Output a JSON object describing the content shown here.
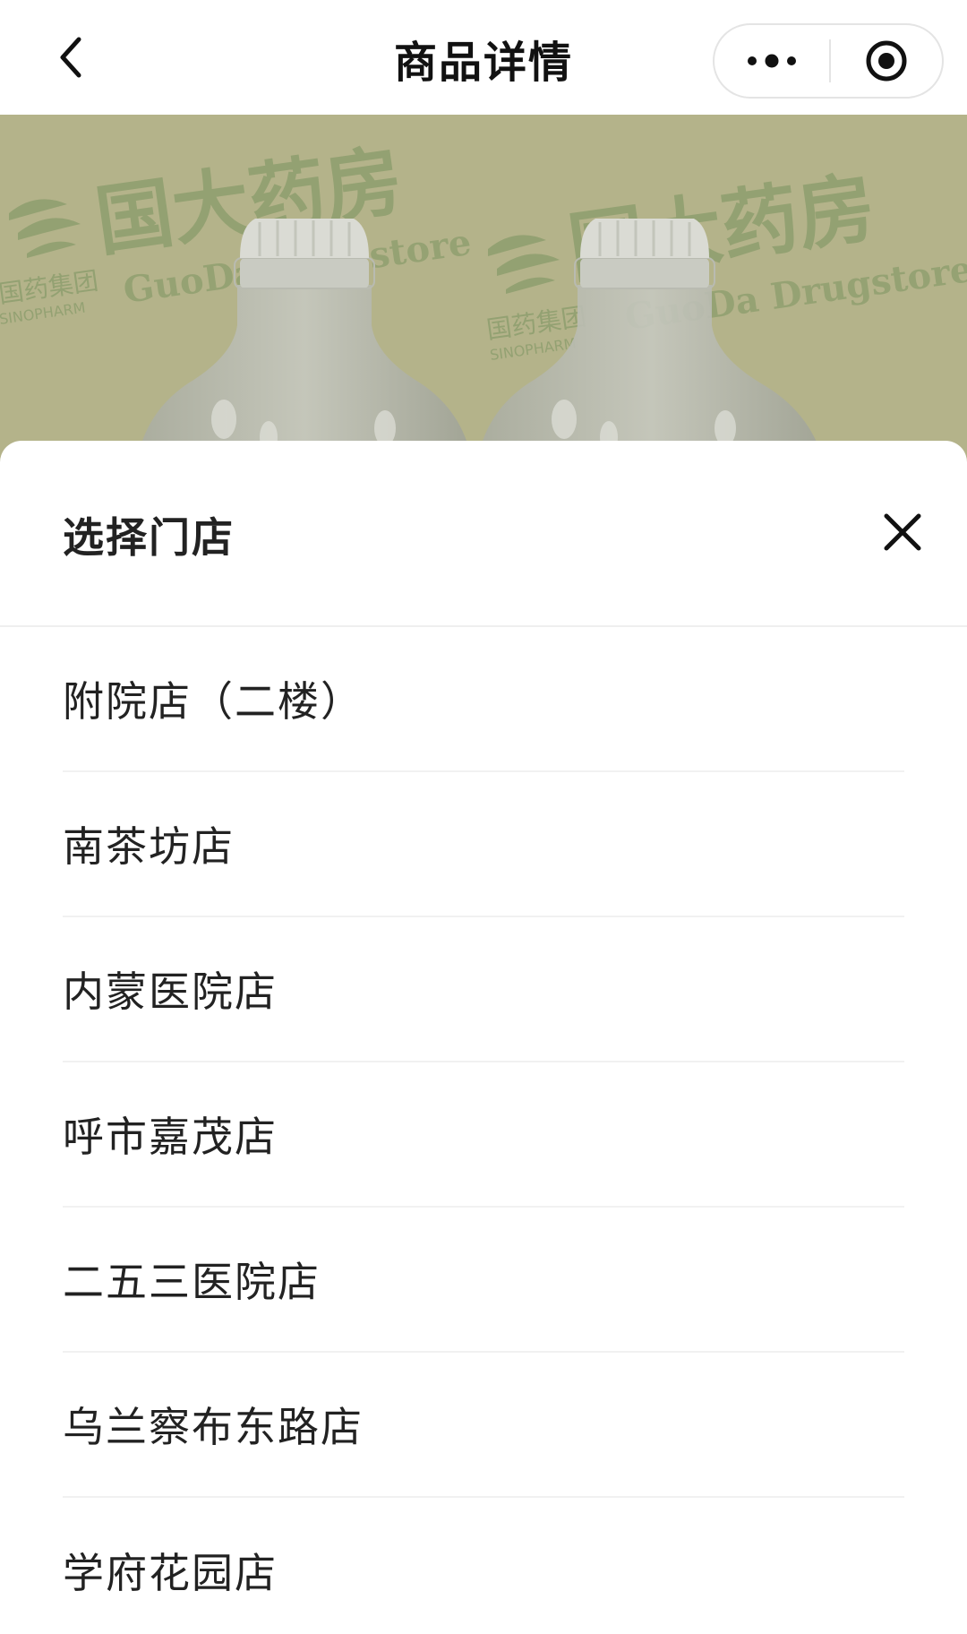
{
  "navbar": {
    "title": "商品详情",
    "back_icon": "chevron-left-icon",
    "more_icon": "more-dots-icon",
    "target_icon": "target-circle-icon"
  },
  "product_image": {
    "watermark_cn": "国大药房",
    "watermark_en": "GuoDa Drugstore",
    "brand_cn": "国药集团",
    "brand_en": "SINOPHARM",
    "background_color": "#b4b38a"
  },
  "sheet": {
    "title": "选择门店",
    "close_icon": "close-x-icon",
    "stores": [
      {
        "name": "附院店（二楼）"
      },
      {
        "name": "南茶坊店"
      },
      {
        "name": "内蒙医院店"
      },
      {
        "name": "呼市嘉茂店"
      },
      {
        "name": "二五三医院店"
      },
      {
        "name": "乌兰察布东路店"
      },
      {
        "name": "学府花园店"
      }
    ]
  }
}
